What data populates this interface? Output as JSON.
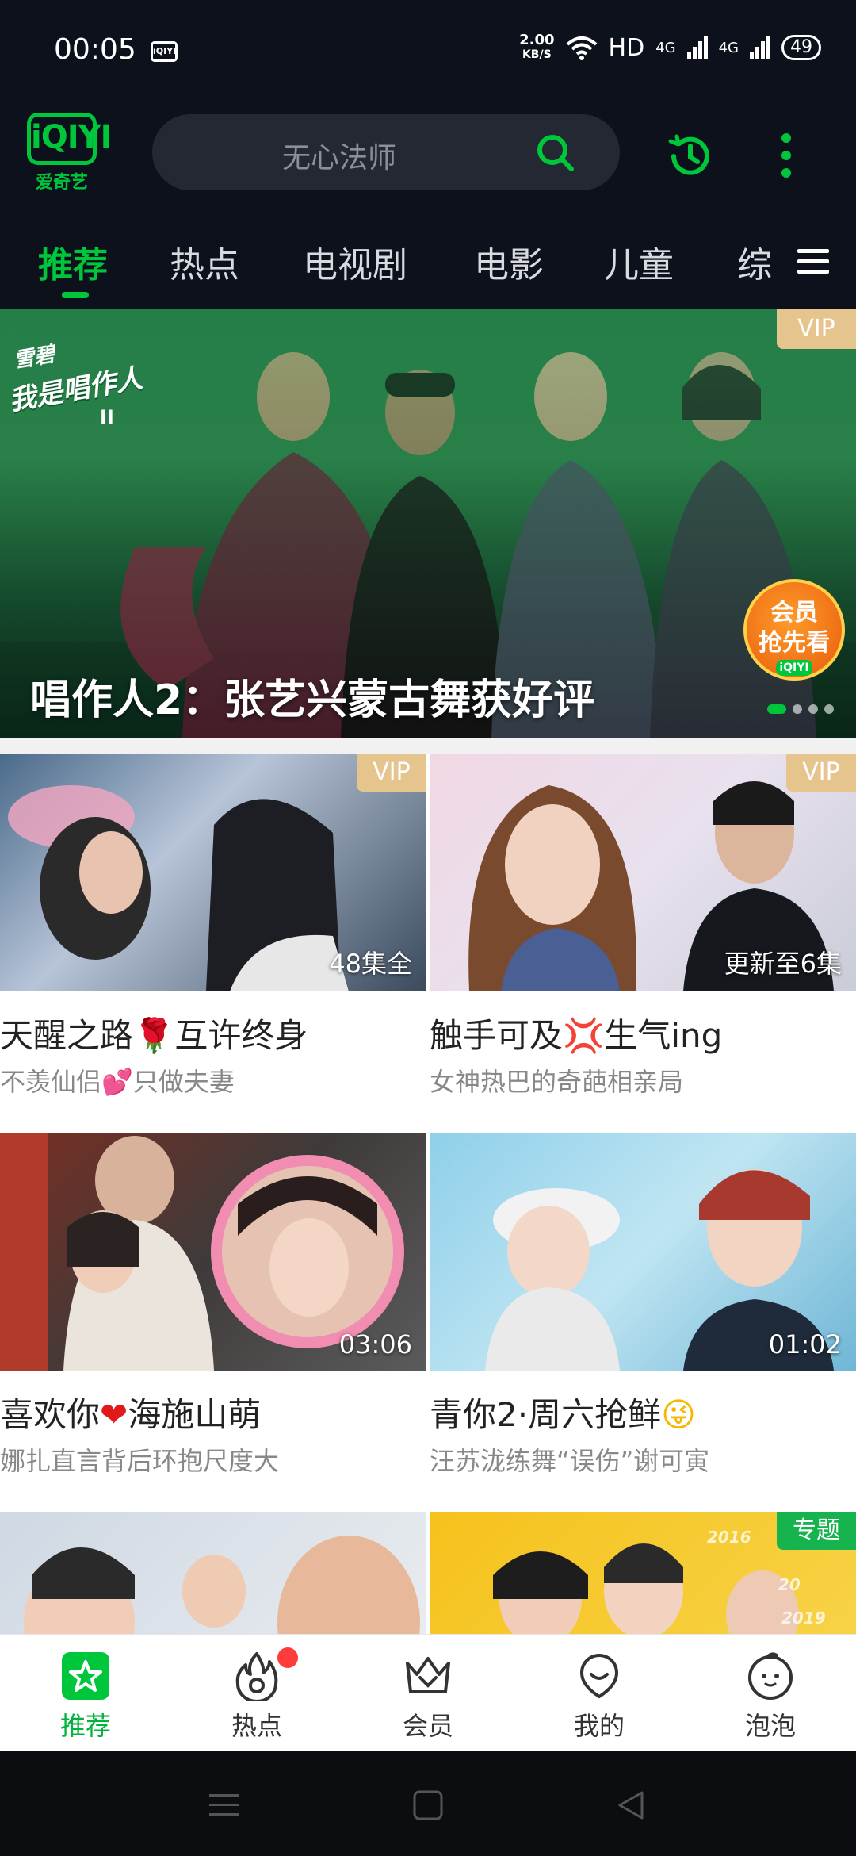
{
  "status_bar": {
    "time": "00:05",
    "app_badge": "iQIYI",
    "net_speed_value": "2.00",
    "net_speed_unit": "KB/S",
    "hd": "HD",
    "sig1": "4G",
    "sig2": "4G",
    "battery": "49"
  },
  "header": {
    "logo_text": "iQIYI",
    "logo_sub": "爱奇艺",
    "search_placeholder": "无心法师"
  },
  "tabs": {
    "items": [
      "推荐",
      "热点",
      "电视剧",
      "电影",
      "儿童",
      "综"
    ],
    "active_index": 0
  },
  "banner": {
    "title": "唱作人2：张艺兴蒙古舞获好评",
    "badge": "VIP",
    "show_logo_top": "雪碧",
    "show_logo_main": "我是唱作人",
    "show_logo_num": "II",
    "promo_line1": "会员",
    "promo_line2": "抢先看",
    "promo_small": "iQIYI",
    "page_count": 4,
    "current_page": 0
  },
  "cards": [
    {
      "title_pre": "天醒之路",
      "emoji": "🌹",
      "title_post": "互许终身",
      "subtitle_pre": "不羡仙侣",
      "sub_emoji": "💕",
      "subtitle_post": "只做夫妻",
      "badge": "VIP",
      "corner": "48集全"
    },
    {
      "title_pre": "触手可及",
      "emoji": "💢",
      "title_post": "生气ing",
      "subtitle_pre": "女神热巴的奇葩相亲局",
      "sub_emoji": "",
      "subtitle_post": "",
      "badge": "VIP",
      "corner": "更新至6集"
    },
    {
      "title_pre": "喜欢你",
      "emoji": "❤",
      "title_post": "海施山萌",
      "subtitle_pre": "娜扎直言背后环抱尺度大",
      "sub_emoji": "",
      "subtitle_post": "",
      "badge": "",
      "corner": "03:06"
    },
    {
      "title_pre": "青你2·周六抢鲜",
      "emoji": "😜",
      "title_post": "",
      "subtitle_pre": "汪苏泷练舞“误伤”谢可寅",
      "sub_emoji": "",
      "subtitle_post": "",
      "badge": "",
      "corner": "01:02"
    }
  ],
  "partial_row": {
    "right_badge": "专题",
    "years": [
      "2016",
      "20",
      "2019",
      "2019"
    ]
  },
  "bottom_nav": {
    "items": [
      "推荐",
      "热点",
      "会员",
      "我的",
      "泡泡"
    ],
    "active_index": 0,
    "hot_has_dot": true
  },
  "colors": {
    "accent": "#00c63b",
    "header_bg": "#0c111b",
    "vip": "#e6c48d"
  }
}
